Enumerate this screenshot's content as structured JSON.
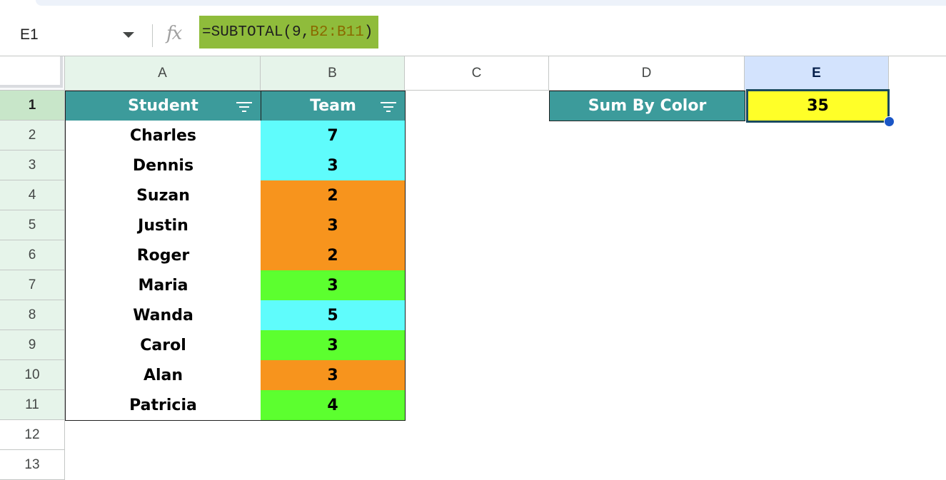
{
  "formula_bar": {
    "name_box": "E1",
    "fx_label": "fx",
    "formula_prefix": "=SUBTOTAL(9,",
    "formula_ref": "B2:B11",
    "formula_suffix": ")"
  },
  "columns": [
    "A",
    "B",
    "C",
    "D",
    "E"
  ],
  "rows": [
    "1",
    "2",
    "3",
    "4",
    "5",
    "6",
    "7",
    "8",
    "9",
    "10",
    "11",
    "12",
    "13"
  ],
  "table": {
    "header": {
      "student": "Student",
      "team": "Team"
    },
    "rows": [
      {
        "student": "Charles",
        "team": "7",
        "color": "#5ffcfc"
      },
      {
        "student": "Dennis",
        "team": "3",
        "color": "#5ffcfc"
      },
      {
        "student": "Suzan",
        "team": "2",
        "color": "#f7941d"
      },
      {
        "student": "Justin",
        "team": "3",
        "color": "#f7941d"
      },
      {
        "student": "Roger",
        "team": "2",
        "color": "#f7941d"
      },
      {
        "student": "Maria",
        "team": "3",
        "color": "#5cff2f"
      },
      {
        "student": "Wanda",
        "team": "5",
        "color": "#5ffcfc"
      },
      {
        "student": "Carol",
        "team": "3",
        "color": "#5cff2f"
      },
      {
        "student": "Alan",
        "team": "3",
        "color": "#f7941d"
      },
      {
        "student": "Patricia",
        "team": "4",
        "color": "#5cff2f"
      }
    ]
  },
  "summary": {
    "label": "Sum By Color",
    "value": "35"
  },
  "colors": {
    "header_teal": "#3c9b9b",
    "result_yellow": "#ffff28",
    "formula_highlight": "#8fbc3b",
    "selection_blue": "#1a56c6"
  }
}
